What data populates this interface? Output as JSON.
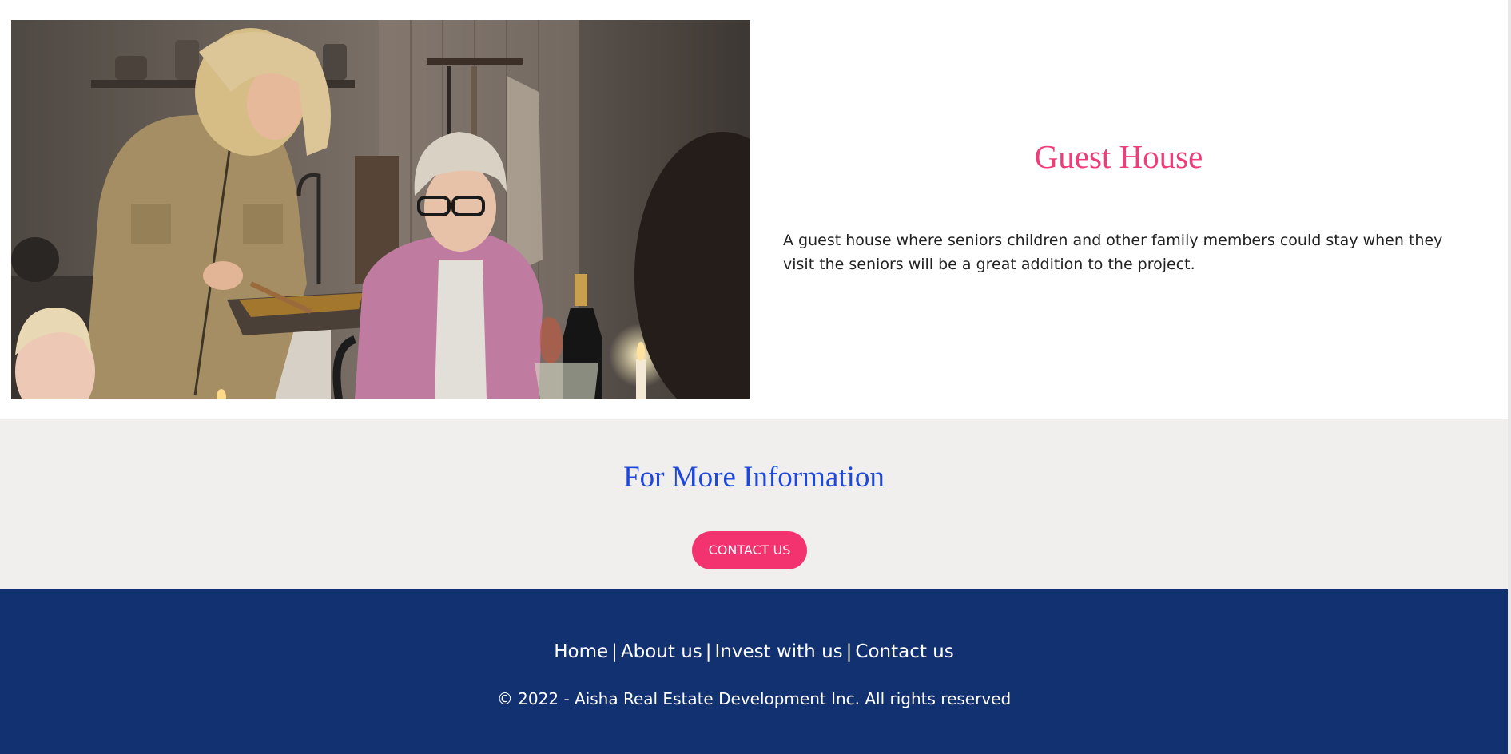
{
  "guest_house": {
    "title": "Guest House",
    "description": "A guest house where seniors children and other family members could stay when they visit the seniors will be a great addition to the project."
  },
  "more_info": {
    "title": "For More Information",
    "contact_button": "CONTACT US"
  },
  "footer": {
    "nav": [
      {
        "label": "Home"
      },
      {
        "label": "About us"
      },
      {
        "label": "Invest with us"
      },
      {
        "label": "Contact us"
      }
    ],
    "separator": "|",
    "copyright": "© 2022 - Aisha Real Estate Development Inc. All rights reserved"
  },
  "colors": {
    "accent_pink": "#f2336f",
    "title_pink": "#ee3d7a",
    "title_blue": "#1d47dd",
    "footer_navy": "#123171",
    "info_background": "#f0efed"
  }
}
